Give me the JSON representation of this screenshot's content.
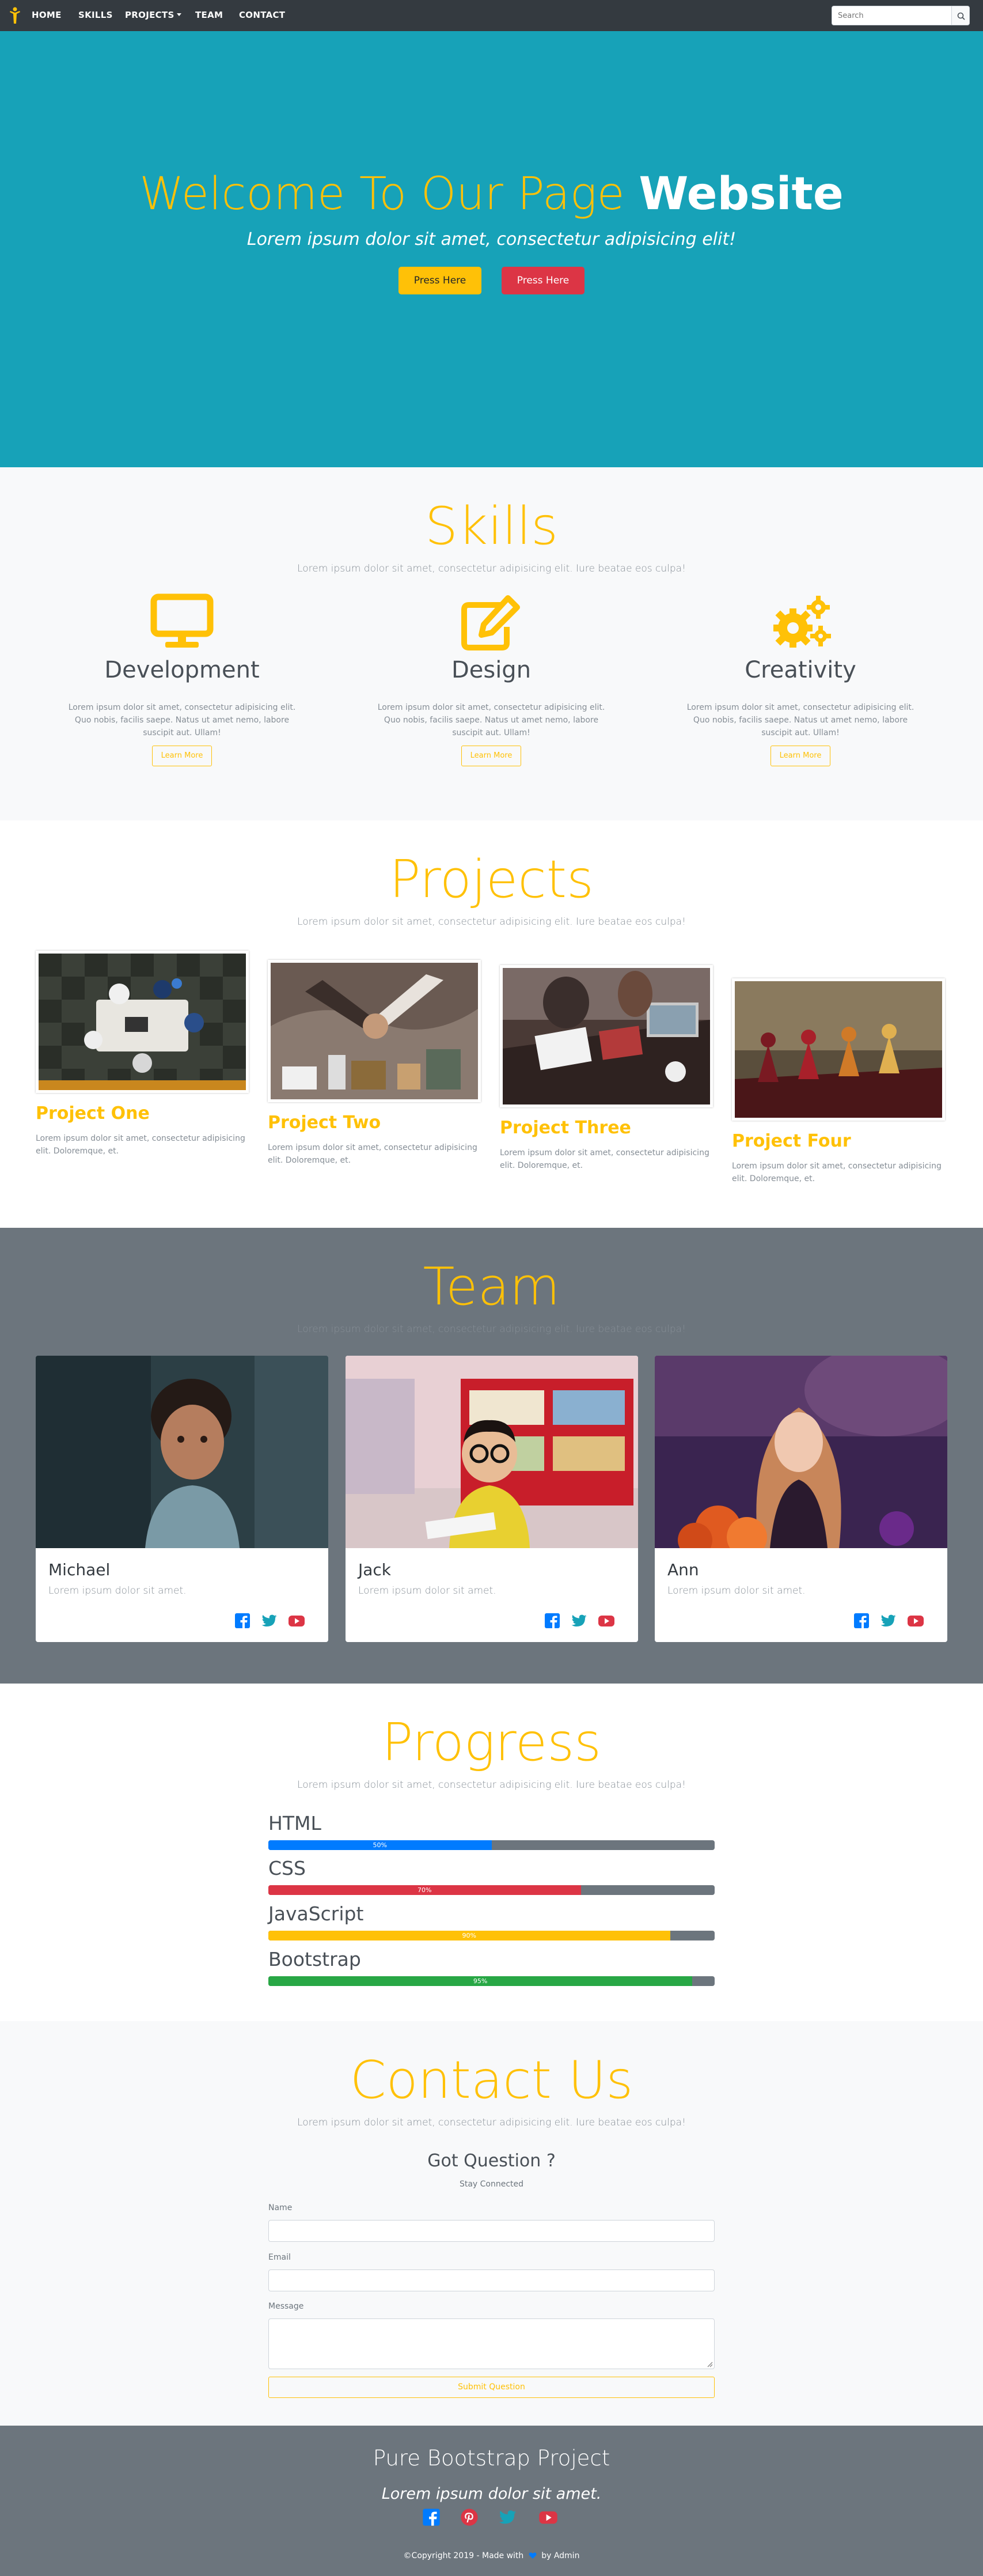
{
  "nav": {
    "items": [
      "HOME",
      "SKILLS",
      "PROJECTS",
      "TEAM",
      "CONTACT"
    ],
    "search_placeholder": "Search"
  },
  "hero": {
    "title_light": "Welcome To Our Page",
    "title_bold": "Website",
    "subtitle": "Lorem ipsum dolor sit amet, consectetur adipisicing elit!",
    "button1": "Press Here",
    "button2": "Press Here"
  },
  "skills": {
    "title": "Skills",
    "subtitle": "Lorem ipsum dolor sit amet, consectetur adipisicing elit. Iure beatae eos culpa!",
    "items": [
      {
        "name": "Development",
        "icon": "monitor-icon",
        "text": "Lorem ipsum dolor sit amet, consectetur adipisicing elit. Quo nobis, facilis saepe. Natus ut amet nemo, labore suscipit aut. Ullam!",
        "button": "Learn More"
      },
      {
        "name": "Design",
        "icon": "edit-icon",
        "text": "Lorem ipsum dolor sit amet, consectetur adipisicing elit. Quo nobis, facilis saepe. Natus ut amet nemo, labore suscipit aut. Ullam!",
        "button": "Learn More"
      },
      {
        "name": "Creativity",
        "icon": "gears-icon",
        "text": "Lorem ipsum dolor sit amet, consectetur adipisicing elit. Quo nobis, facilis saepe. Natus ut amet nemo, labore suscipit aut. Ullam!",
        "button": "Learn More"
      }
    ]
  },
  "projects": {
    "title": "Projects",
    "subtitle": "Lorem ipsum dolor sit amet, consectetur adipisicing elit. Iure beatae eos culpa!",
    "items": [
      {
        "title": "Project One",
        "text": "Lorem ipsum dolor sit amet, consectetur adipisicing elit. Doloremque, et."
      },
      {
        "title": "Project Two",
        "text": "Lorem ipsum dolor sit amet, consectetur adipisicing elit. Doloremque, et."
      },
      {
        "title": "Project Three",
        "text": "Lorem ipsum dolor sit amet, consectetur adipisicing elit. Doloremque, et."
      },
      {
        "title": "Project Four",
        "text": "Lorem ipsum dolor sit amet, consectetur adipisicing elit. Doloremque, et."
      }
    ]
  },
  "team": {
    "title": "Team",
    "subtitle": "Lorem ipsum dolor sit amet, consectetur adipisicing elit. Iure beatae eos culpa!",
    "members": [
      {
        "name": "Michael",
        "text": "Lorem ipsum dolor sit amet."
      },
      {
        "name": "Jack",
        "text": "Lorem ipsum dolor sit amet."
      },
      {
        "name": "Ann",
        "text": "Lorem ipsum dolor sit amet."
      }
    ]
  },
  "progress": {
    "title": "Progress",
    "subtitle": "Lorem ipsum dolor sit amet, consectetur adipisicing elit. Iure beatae eos culpa!",
    "bars": [
      {
        "label": "HTML",
        "value": 50,
        "text": "50%",
        "color": "#007bff"
      },
      {
        "label": "CSS",
        "value": 70,
        "text": "70%",
        "color": "#dc3545"
      },
      {
        "label": "JavaScript",
        "value": 90,
        "text": "90%",
        "color": "#ffc107"
      },
      {
        "label": "Bootstrap",
        "value": 95,
        "text": "95%",
        "color": "#28a745"
      }
    ]
  },
  "contact": {
    "title": "Contact Us",
    "subtitle": "Lorem ipsum dolor sit amet, consectetur adipisicing elit. Iure beatae eos culpa!",
    "heading": "Got Question ?",
    "subheading": "Stay Connected",
    "name_label": "Name",
    "email_label": "Email",
    "message_label": "Message",
    "submit": "Submit Question"
  },
  "footer": {
    "title": "Pure Bootstrap Project",
    "tagline": "Lorem ipsum dolor sit amet.",
    "copyright_prefix": "©Copyright 2019 - Made with",
    "copyright_suffix": "by Admin"
  },
  "colors": {
    "accent": "#ffc107",
    "hero": "#17a2b8",
    "dark": "#343a40",
    "gray": "#6c757d",
    "danger": "#dc3545",
    "primary": "#007bff"
  }
}
